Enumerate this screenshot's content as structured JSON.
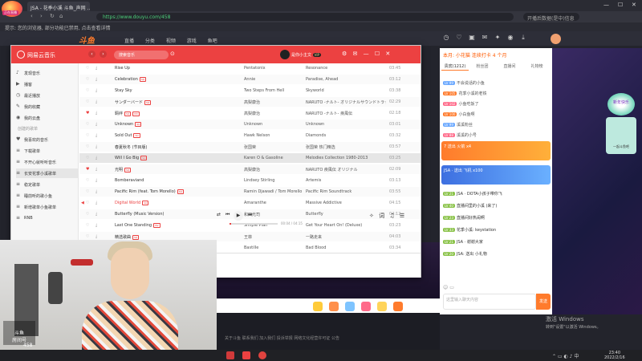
{
  "browser": {
    "tab_title": "JSA - 花季小溪 斗鱼_声网 ...",
    "url": "https://www.douyu.com/458",
    "search_placeholder": "开播后数据(是中)信息",
    "bookmarks": "提示: 您的浏览器, 部分功能已禁用, 点击查看详情",
    "logo_badge": "正在直播"
  },
  "douyu": {
    "logo": "斗鱼",
    "nav": "直播  分类  视频  游戏  鱼吧",
    "footer": "关于斗鱼  联系我们  加入我们  投诉举报  网络文化经营许可证  公告"
  },
  "music": {
    "app_title": "网易云音乐",
    "search_placeholder": "搜索音乐",
    "username": "是你小主文",
    "vip_label": "VIP",
    "sidebar": {
      "items": [
        {
          "icon": "♪",
          "label": "发现音乐"
        },
        {
          "icon": "▶",
          "label": "播客"
        },
        {
          "icon": "◷",
          "label": "最近播放"
        },
        {
          "icon": "✎",
          "label": "我的收藏"
        },
        {
          "icon": "◉",
          "label": "我的云盘"
        }
      ],
      "section_head": "创建的歌单",
      "playlists": [
        {
          "icon": "♥",
          "label": "我喜欢的音乐"
        },
        {
          "icon": "≡",
          "label": "下载歌单"
        },
        {
          "icon": "≡",
          "label": "不开心就听听音乐"
        },
        {
          "icon": "≡",
          "label": "长安花季小溪歌单"
        },
        {
          "icon": "≡",
          "label": "稳定歌单"
        },
        {
          "icon": "≡",
          "label": "睡前听的歌小鱼"
        },
        {
          "icon": "≡",
          "label": "新增歌单小鱼歌单"
        },
        {
          "icon": "≡",
          "label": "RNB"
        }
      ]
    },
    "songs": [
      {
        "title": "Rise Up",
        "tags": [],
        "artist": "Pentatonix",
        "album": "Resonance",
        "time": "03:45",
        "liked": false
      },
      {
        "title": "Celebration",
        "tags": [
          "SQ"
        ],
        "artist": "Annie",
        "album": "Paradise, Ahead",
        "time": "03:12",
        "liked": false
      },
      {
        "title": "Stay Sky",
        "tags": [],
        "artist": "Two Steps From Hell",
        "album": "Skyworld",
        "time": "03:38",
        "liked": false
      },
      {
        "title": "サンダーバード",
        "tags": [
          "SQ"
        ],
        "artist": "高梨康治",
        "album": "NARUTO -ナルト- オリジナルサウンドトラック",
        "time": "02:29",
        "liked": false
      },
      {
        "title": "羁绊",
        "tags": [
          "SQ",
          "MV"
        ],
        "artist": "高梨康治",
        "album": "NARUTO -ナルト- 疾風伝",
        "time": "02:18",
        "liked": true
      },
      {
        "title": "Unknown",
        "tags": [
          "SQ"
        ],
        "artist": "Unknown",
        "album": "Unknown",
        "time": "03:01",
        "liked": false
      },
      {
        "title": "Sold Out",
        "tags": [
          "SQ"
        ],
        "artist": "Hawk Nelson",
        "album": "Diamonds",
        "time": "03:32",
        "liked": false
      },
      {
        "title": "春夏秋冬 (节目版)",
        "tags": [],
        "artist": "张国荣",
        "album": "张国荣 热门精选",
        "time": "03:57",
        "liked": false
      },
      {
        "title": "Will I Go Big",
        "tags": [
          "SQ"
        ],
        "artist": "Karen O & Gasoline",
        "album": "Melodies Collection 1980-2013",
        "time": "03:25",
        "liked": false
      },
      {
        "title": "光明",
        "tags": [
          "SQ"
        ],
        "artist": "高梨康治",
        "album": "NARUTO 疾風伝 オリジナル",
        "time": "02:09",
        "liked": true
      },
      {
        "title": "Bomberaviand",
        "tags": [],
        "artist": "Lindsey Stirling",
        "album": "Artemis",
        "time": "03:13",
        "liked": false
      },
      {
        "title": "Pacific Rim (feat. Tom Morello)",
        "tags": [
          "SQ"
        ],
        "artist": "Ramin Djawadi / Tom Morello",
        "album": "Pacific Rim Soundtrack",
        "time": "03:55",
        "liked": false
      },
      {
        "title": "Digital World",
        "tags": [
          "SQ"
        ],
        "artist": "Amaranthe",
        "album": "Massive Addictive",
        "time": "04:15",
        "liked": false,
        "playing": true
      },
      {
        "title": "Butterfly (Music Version)",
        "tags": [],
        "artist": "和田光司",
        "album": "Butterfly",
        "time": "04:12",
        "liked": false
      },
      {
        "title": "Last One Standing",
        "tags": [
          "MV"
        ],
        "artist": "Simple Plan",
        "album": "Get Your Heart On! (Deluxe)",
        "time": "03:23",
        "liked": false
      },
      {
        "title": "精选歌曲",
        "tags": [
          "SQ"
        ],
        "artist": "王菲",
        "album": "一路走来",
        "time": "04:03",
        "liked": false
      },
      {
        "title": "Pompeii",
        "tags": [
          "SQ"
        ],
        "artist": "Bastille",
        "album": "Bad Blood",
        "time": "03:34",
        "liked": false
      }
    ],
    "player": {
      "time": "00:04 / 04:15",
      "progress": 0.04
    }
  },
  "chat": {
    "top_text": "本月: 小花猫 连续打卡 4 个月",
    "tabs": [
      "贵宾(1212)",
      "粉丝团",
      "直播间",
      "礼物榜"
    ],
    "ranks": [
      {
        "lvl": "LV 99",
        "name": "不会说话的小鱼"
      },
      {
        "lvl": "LV 105",
        "name": "花季小溪的老铁"
      },
      {
        "lvl": "LV 102",
        "name": "小鱼吃饭了"
      },
      {
        "lvl": "LV 100",
        "name": "小白鱼啊"
      },
      {
        "lvl": "LV 99",
        "name": "溪溪粉丝"
      },
      {
        "lvl": "LV 88",
        "name": "溪溪的小号"
      }
    ],
    "banners": [
      {
        "text": "7 送出 火箭 x4",
        "color": "#ff9c3a"
      },
      {
        "text": "JSA · 送出 飞机 x100",
        "color": "#4a8cff"
      }
    ],
    "messages": [
      {
        "lvl": "LV 21",
        "text": "JSA · DOTA小孩子带你飞"
      },
      {
        "lvl": "LV 40",
        "text": "直播间里的小溪 (来了)"
      },
      {
        "lvl": "LV 23",
        "text": "直播间好热闹啊"
      },
      {
        "lvl": "LV 33",
        "text": "花季小溪: keystation"
      },
      {
        "lvl": "LV 21",
        "text": "JSA · 谢谢大家"
      },
      {
        "lvl": "LV 20",
        "text": "JSA: 送出 小礼物"
      }
    ],
    "input_placeholder": "这里输入聊天内容",
    "send_label": "发送",
    "side_badge1": "新年快乐",
    "side_badge2": "一起斗鱼吧"
  },
  "watermark": {
    "line1": "激活 Windows",
    "line2": "转到\"设置\"以激活 Windows。"
  },
  "taskbar": {
    "time": "23:40",
    "date": "2022/2/16"
  },
  "cam": {
    "logo": "斗鱼",
    "room_label": "房间号",
    "room_num": "458"
  }
}
